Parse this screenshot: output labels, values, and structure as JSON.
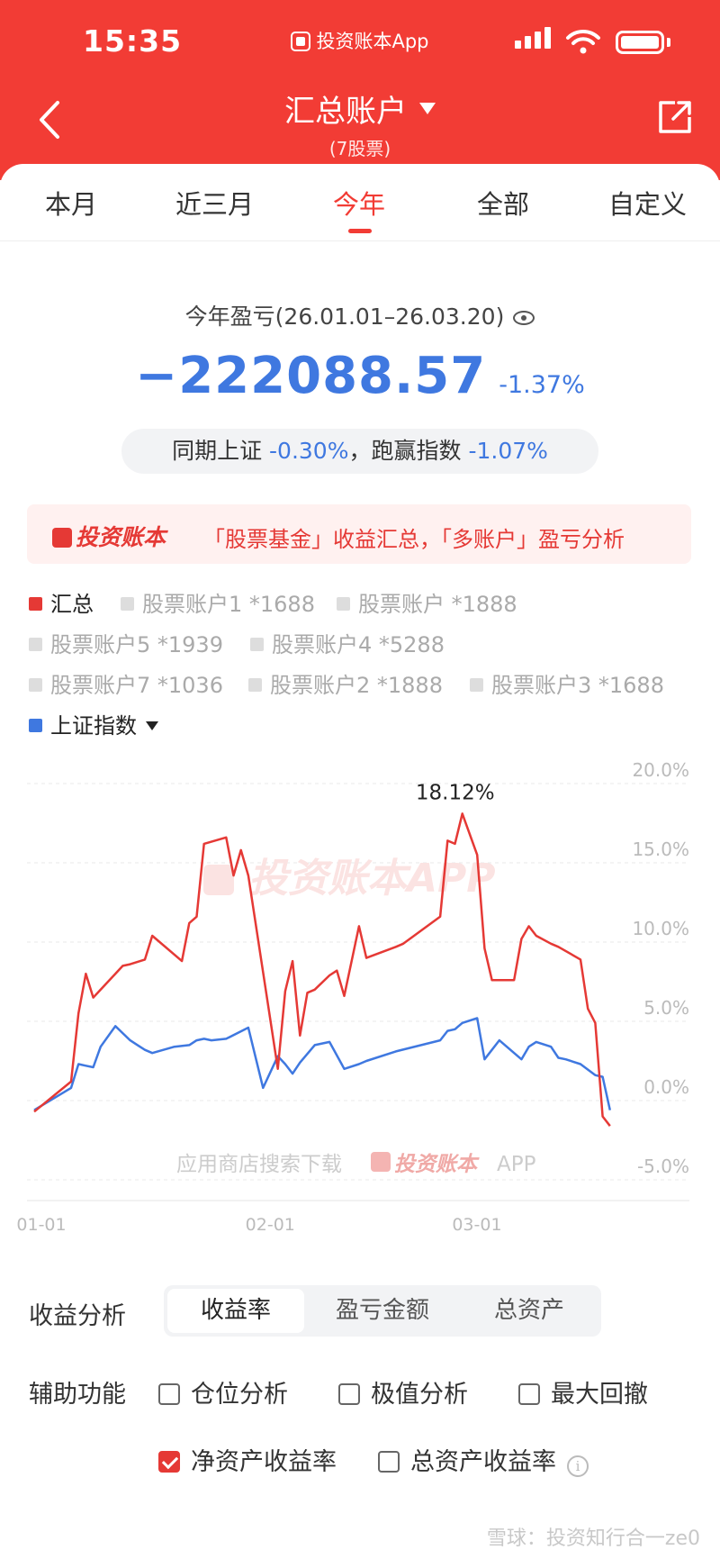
{
  "status_bar": {
    "time": "15:35",
    "app_name": "投资账本App"
  },
  "header": {
    "title": "汇总账户",
    "subtitle": "(7股票)"
  },
  "tabs": [
    {
      "label": "本月"
    },
    {
      "label": "近三月"
    },
    {
      "label": "今年",
      "active": true
    },
    {
      "label": "全部"
    },
    {
      "label": "自定义"
    }
  ],
  "summary": {
    "period_label": "今年盈亏(26.01.01–26.03.20)",
    "pnl_value": "−222088.57",
    "pnl_pct": "-1.37%",
    "compare_label_1": "同期上证",
    "compare_value_1": "-0.30%",
    "compare_sep": "，",
    "compare_label_2": "跑赢指数",
    "compare_value_2": "-1.07%"
  },
  "promo": {
    "logo": "投资账本",
    "text": "「股票基金」收益汇总，「多账户」盈亏分析"
  },
  "legend": [
    {
      "label": "汇总",
      "on": true,
      "color": "red"
    },
    {
      "label": "股票账户1 *1688"
    },
    {
      "label": "股票账户 *1888"
    },
    {
      "label": "股票账户5 *1939"
    },
    {
      "label": "股票账户4 *5288"
    },
    {
      "label": "股票账户7 *1036"
    },
    {
      "label": "股票账户2 *1888"
    },
    {
      "label": "股票账户3 *1688"
    },
    {
      "label": "上证指数",
      "on": true,
      "color": "blue"
    }
  ],
  "colors": {
    "accent": "#f23c35",
    "series_total": "#e53935",
    "series_index": "#3f78e0"
  },
  "chart_data": {
    "type": "line",
    "y_ticks": [
      "20.0%",
      "15.0%",
      "10.0%",
      "5.0%",
      "0.0%",
      "-5.0%"
    ],
    "ylim": [
      -5,
      20
    ],
    "x_ticks": [
      "01-01",
      "02-01",
      "03-01"
    ],
    "x_tick_positions": [
      0,
      31,
      59
    ],
    "xlim": [
      0,
      79
    ],
    "peak_label": "18.12%",
    "watermark_center": "投资账本APP",
    "watermark_bottom": "应用商店搜索下载",
    "watermark_bottom_logo": "投资账本",
    "watermark_bottom_app": "APP",
    "series": [
      {
        "name": "汇总",
        "x": [
          0,
          5,
          6,
          7,
          8,
          10,
          12,
          13,
          15,
          16,
          20,
          21,
          22,
          23,
          26,
          27,
          28,
          29,
          33,
          34,
          35,
          36,
          37,
          38,
          40,
          41,
          42,
          44,
          45,
          49,
          50,
          55,
          56,
          57,
          58,
          60,
          61,
          62,
          65,
          66,
          67,
          68,
          70,
          71,
          74,
          75,
          76,
          77,
          78
        ],
        "y": [
          -0.7,
          1.2,
          5.5,
          8.0,
          6.5,
          7.5,
          8.5,
          8.6,
          8.9,
          10.4,
          8.8,
          11.2,
          11.6,
          16.2,
          16.6,
          14.2,
          15.8,
          14.2,
          2.0,
          6.9,
          8.8,
          4.1,
          6.8,
          7.0,
          7.9,
          8.2,
          6.6,
          11.0,
          9.0,
          9.7,
          9.9,
          11.6,
          16.4,
          16.2,
          18.1,
          15.5,
          9.6,
          7.6,
          7.6,
          10.2,
          11.0,
          10.4,
          9.9,
          9.7,
          8.9,
          5.8,
          4.9,
          -1.0,
          -1.6
        ]
      },
      {
        "name": "上证指数",
        "x": [
          0,
          5,
          6,
          7,
          8,
          9,
          11,
          13,
          14,
          15,
          16,
          19,
          21,
          22,
          23,
          24,
          26,
          29,
          31,
          33,
          34,
          35,
          36,
          38,
          40,
          42,
          44,
          45,
          49,
          55,
          56,
          57,
          58,
          60,
          61,
          63,
          66,
          67,
          68,
          70,
          71,
          72,
          74,
          76,
          77,
          78
        ],
        "y": [
          -0.6,
          0.8,
          2.3,
          2.2,
          2.1,
          3.4,
          4.7,
          3.8,
          3.5,
          3.2,
          3.0,
          3.4,
          3.5,
          3.8,
          3.9,
          3.8,
          3.9,
          4.6,
          0.8,
          2.8,
          2.3,
          1.7,
          2.4,
          3.5,
          3.7,
          2.0,
          2.3,
          2.5,
          3.1,
          3.8,
          4.4,
          4.5,
          4.9,
          5.2,
          2.6,
          3.8,
          2.6,
          3.4,
          3.7,
          3.4,
          2.7,
          2.6,
          2.3,
          1.6,
          1.5,
          -0.6
        ]
      }
    ]
  },
  "analysis": {
    "label": "收益分析",
    "segments": [
      "收益率",
      "盈亏金额",
      "总资产"
    ],
    "active_segment": 0
  },
  "aux": {
    "label": "辅助功能",
    "options": [
      {
        "label": "仓位分析",
        "checked": false
      },
      {
        "label": "极值分析",
        "checked": false
      },
      {
        "label": "最大回撤",
        "checked": false
      },
      {
        "label": "净资产收益率",
        "checked": true
      },
      {
        "label": "总资产收益率",
        "checked": false
      }
    ]
  },
  "footer_watermark": "雪球：投资知行合一ze0"
}
